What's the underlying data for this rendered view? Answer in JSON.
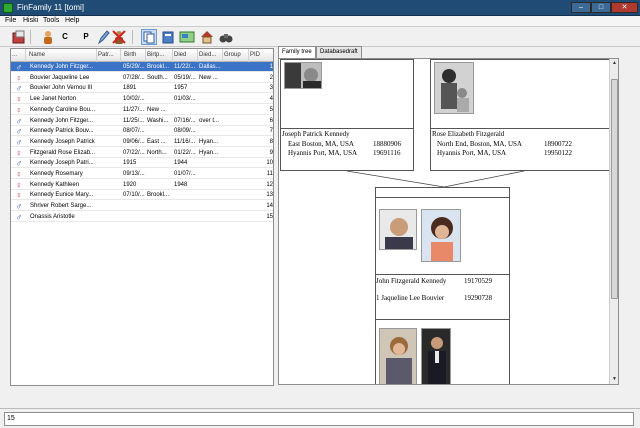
{
  "window": {
    "title": "FinFamily 11 [tomi]",
    "min": "–",
    "max": "□",
    "close": "✕"
  },
  "menu": [
    "File",
    "Hiski",
    "Tools",
    "Help"
  ],
  "toolbar": {
    "c_label": "C",
    "p_label": "P"
  },
  "list": {
    "headers": [
      "...",
      "Name",
      "Patr...",
      "Birth",
      "Birtp...",
      "Died",
      "Died...",
      "Group",
      "PID"
    ],
    "rows": [
      {
        "g": "m",
        "name": "Kennedy John Fitzger...",
        "birth": "05/29/...",
        "bplace": "Brookl...",
        "died": "11/22/...",
        "dplace": "Dallas...",
        "pid": "1"
      },
      {
        "g": "f",
        "name": "Bouvier Jaqueline Lee",
        "birth": "07/28/...",
        "bplace": "South...",
        "died": "05/19/...",
        "dplace": "New ...",
        "pid": "2"
      },
      {
        "g": "m",
        "name": "Bouvier John Vernou III",
        "birth": "1891",
        "bplace": "",
        "died": "1957",
        "dplace": "",
        "pid": "3"
      },
      {
        "g": "f",
        "name": "Lee Janet Norton",
        "birth": "10/02/...",
        "bplace": "",
        "died": "01/03/...",
        "dplace": "",
        "pid": "4"
      },
      {
        "g": "f",
        "name": "Kennedy Caroline Bou...",
        "birth": "11/27/...",
        "bplace": "New ...",
        "died": "",
        "dplace": "",
        "pid": "5"
      },
      {
        "g": "m",
        "name": "Kennedy John Fitzger...",
        "birth": "11/25/...",
        "bplace": "Washi...",
        "died": "07/16/...",
        "dplace": "over t...",
        "pid": "6"
      },
      {
        "g": "m",
        "name": "Kennedy Patrick Bouv...",
        "birth": "08/07/...",
        "bplace": "",
        "died": "08/09/...",
        "dplace": "",
        "pid": "7"
      },
      {
        "g": "m",
        "name": "Kennedy Joseph Patrick",
        "birth": "09/06/...",
        "bplace": "East ...",
        "died": "11/16/...",
        "dplace": "Hyan...",
        "pid": "8"
      },
      {
        "g": "f",
        "name": "Fitzgerald Rose Elizab...",
        "birth": "07/22/...",
        "bplace": "North...",
        "died": "01/22/...",
        "dplace": "Hyan...",
        "pid": "9"
      },
      {
        "g": "m",
        "name": "Kennedy Joseph Patri...",
        "birth": "1915",
        "bplace": "",
        "died": "1944",
        "dplace": "",
        "pid": "10"
      },
      {
        "g": "f",
        "name": "Kennedy Rosemary",
        "birth": "09/13/...",
        "bplace": "",
        "died": "01/07/...",
        "dplace": "",
        "pid": "11"
      },
      {
        "g": "f",
        "name": "Kennedy Kathleen",
        "birth": "1920",
        "bplace": "",
        "died": "1948",
        "dplace": "",
        "pid": "12"
      },
      {
        "g": "f",
        "name": "Kennedy Eunice Mary...",
        "birth": "07/10/...",
        "bplace": "Brookl...",
        "died": "",
        "dplace": "",
        "pid": "13"
      },
      {
        "g": "m",
        "name": "Shriver Robert Sarge...",
        "birth": "",
        "bplace": "",
        "died": "",
        "dplace": "",
        "pid": "14"
      },
      {
        "g": "m",
        "name": "Onassis Aristotle",
        "birth": "",
        "bplace": "",
        "died": "",
        "dplace": "",
        "pid": "15"
      }
    ]
  },
  "tabs": [
    "Family tree",
    "Databasedraft"
  ],
  "tree": {
    "father": {
      "name": "Joseph Patrick Kennedy",
      "place1": "East Boston, MA, USA",
      "date1": "18880906",
      "place2": "Hyannis Port, MA, USA",
      "date2": "19691116"
    },
    "mother": {
      "name": "Rose Elizabeth Fitzgerald",
      "place1": "North End, Boston, MA, USA",
      "date1": "18900722",
      "place2": "Hyannis Port, MA, USA",
      "date2": "19950122"
    },
    "couple": {
      "p1_name": "John Fitzgerald Kennedy",
      "p1_date": "19170529",
      "p2_name": "1 Jaqueline Lee Bouvier",
      "p2_date": "19290728"
    }
  },
  "status": {
    "text": "15"
  },
  "colors": {
    "selection": "#3b74c6",
    "male": "#1e46b4",
    "female": "#c8283c"
  }
}
